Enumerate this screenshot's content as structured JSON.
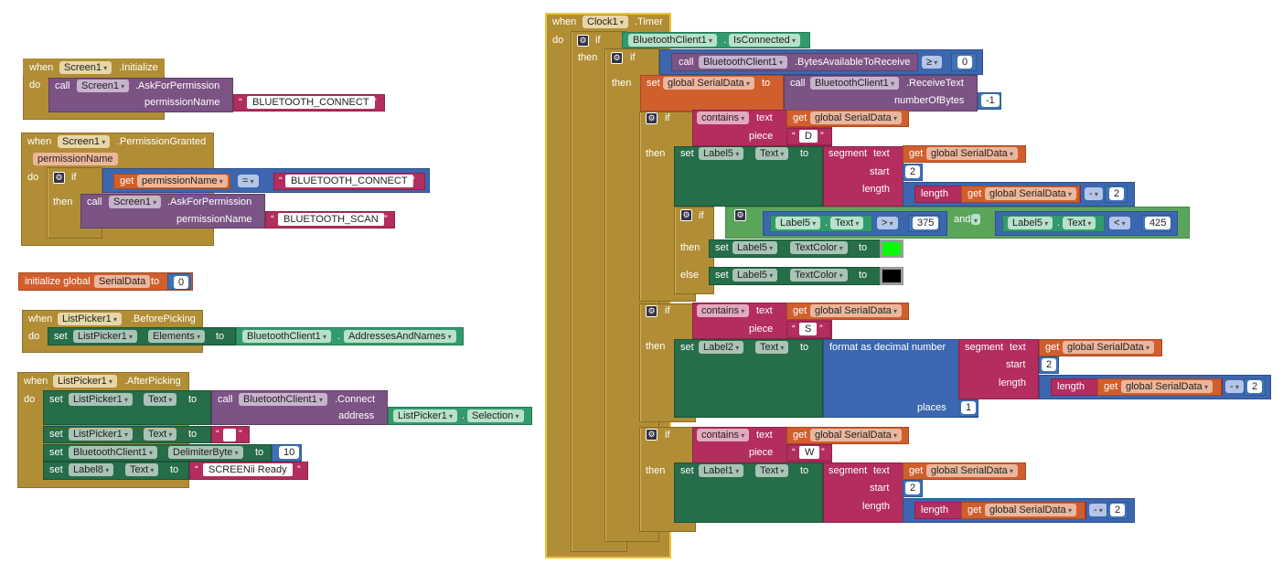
{
  "kw": {
    "when": "when",
    "do": "do",
    "call": "call",
    "if": "if",
    "then": "then",
    "else": "else",
    "set": "set",
    "to": "to",
    "get": "get",
    "and": "and",
    "text": "text",
    "piece": "piece",
    "start": "start",
    "length": "length",
    "places": "places",
    "contains": "contains",
    "segment": "segment",
    "format": "format as decimal number",
    "init": "initialize global",
    "address": "address",
    "permissionName": "permissionName",
    "numberOfBytes": "numberOfBytes",
    "q": "“",
    "qe": "”"
  },
  "comp": {
    "screen1": "Screen1",
    "listpicker1": "ListPicker1",
    "bt": "BluetoothClient1",
    "clock1": "Clock1",
    "label1": "Label1",
    "label2": "Label2",
    "label5": "Label5",
    "label8": "Label8"
  },
  "ev": {
    "initialize": ".Initialize",
    "permGranted": ".PermissionGranted",
    "beforePicking": ".BeforePicking",
    "afterPicking": ".AfterPicking",
    "timer": ".Timer"
  },
  "meth": {
    "askPerm": ".AskForPermission",
    "connect": ".Connect",
    "bytesAvail": ".BytesAvailableToReceive",
    "receiveText": ".ReceiveText"
  },
  "prop": {
    "isConnected": "IsConnected",
    "elements": "Elements",
    "addrNames": "AddressesAndNames",
    "selection": "Selection",
    "text": "Text",
    "delim": "DelimiterByte",
    "textColor": "TextColor"
  },
  "vals": {
    "btConnect": "BLUETOOTH_CONNECT",
    "btScan": "BLUETOOTH_SCAN",
    "screenReady": "SCREENii Ready",
    "zero": "0",
    "ten": "10",
    "minus1": "-1",
    "two": "2",
    "one": "1",
    "n375": "375",
    "n425": "425",
    "D": "D",
    "S": "S",
    "W": "W",
    "globalSerial": "global SerialData",
    "serialData": "SerialData",
    "permissionName": "permissionName"
  },
  "ops": {
    "eq": "=",
    "ge": "≥",
    "gt": ">",
    "lt": "<",
    "minus": "-"
  },
  "colors": {
    "green": "#00ff00",
    "black": "#000000"
  }
}
